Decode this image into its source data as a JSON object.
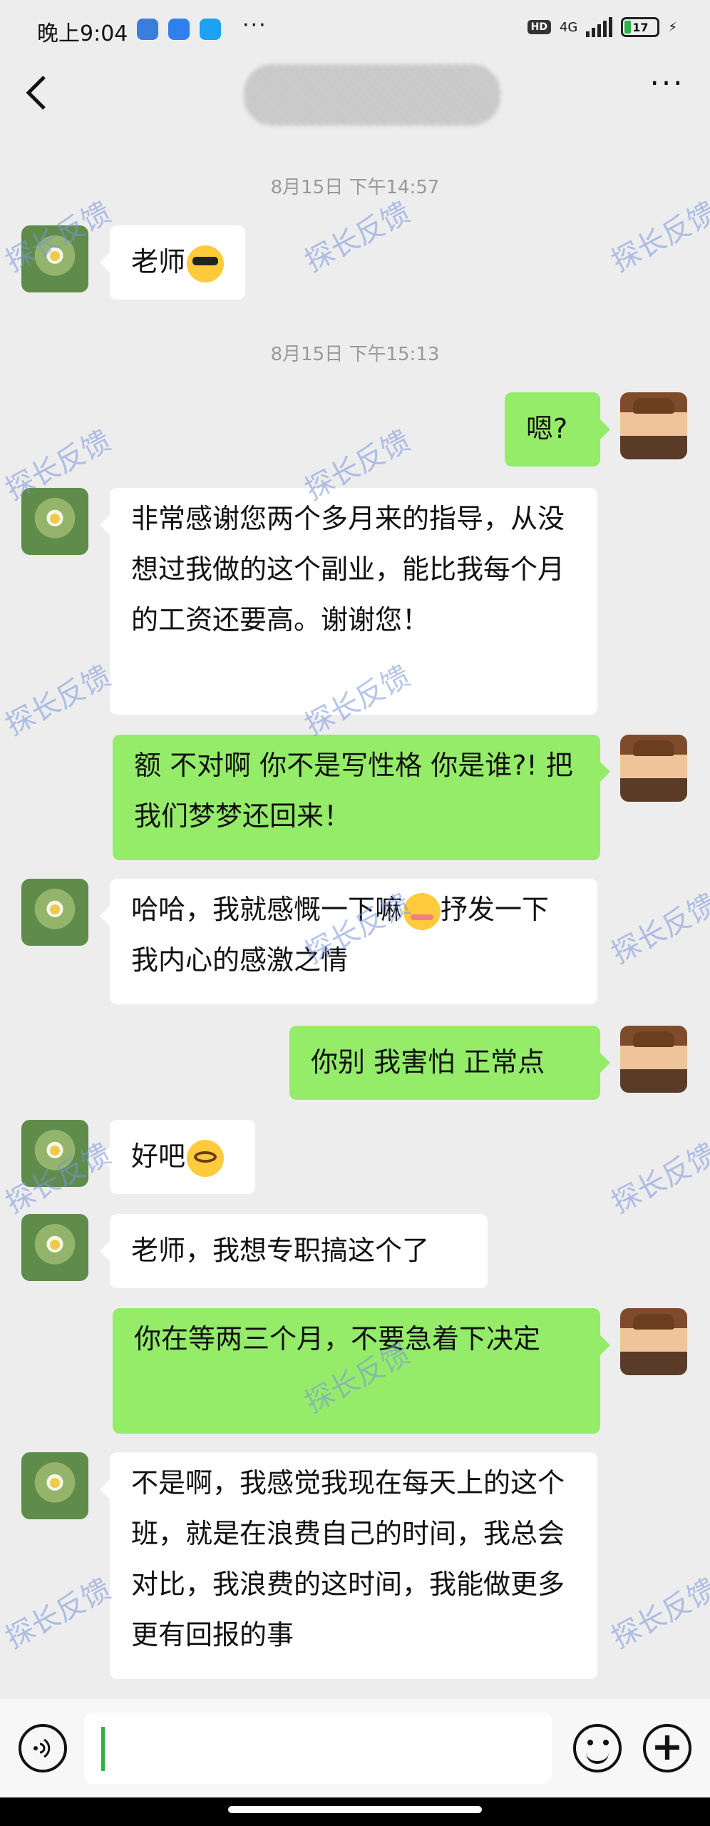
{
  "statusbar": {
    "time": "晚上9:04",
    "more": "···",
    "hd": "HD",
    "network": "4G",
    "battery": "17",
    "app_colors": [
      "#3b7ddd",
      "#2f80ed",
      "#1da1f2"
    ]
  },
  "navbar": {
    "back_icon": "chevron-left-icon",
    "contact_name": "",
    "more_label": "···"
  },
  "chat": {
    "timestamps": [
      "8月15日 下午14:57",
      "8月15日 下午15:13"
    ],
    "messages": [
      {
        "side": "left",
        "text": "老师",
        "emoji": "sunglasses-face"
      },
      {
        "side": "right",
        "text": "嗯?"
      },
      {
        "side": "left",
        "text": "非常感谢您两个多月来的指导，从没想过我做的这个副业，能比我每个月的工资还要高。谢谢您！"
      },
      {
        "side": "right",
        "text": "额 不对啊 你不是写性格 你是谁?! 把我们梦梦还回来！"
      },
      {
        "side": "left",
        "text_before": "哈哈，我就感慨一下嘛",
        "emoji": "blushing-face",
        "text_after": "抒发一下我内心的感激之情"
      },
      {
        "side": "right",
        "text": "你别 我害怕 正常点"
      },
      {
        "side": "left",
        "text": "好吧",
        "emoji": "pleading-face"
      },
      {
        "side": "left",
        "text": "老师，我想专职搞这个了"
      },
      {
        "side": "right",
        "text": "你在等两三个月，不要急着下决定"
      },
      {
        "side": "left",
        "text": "不是啊，我感觉我现在每天上的这个班，就是在浪费自己的时间，我总会对比，我浪费的这时间，我能做更多更有回报的事"
      }
    ]
  },
  "watermark": "探长反馈",
  "inputbar": {
    "voice_icon": "voice-icon",
    "input_value": "",
    "emoji_icon": "emoji-icon",
    "plus_icon": "plus-icon",
    "plus_label": "+"
  },
  "colors": {
    "background": "#ededed",
    "bubble_self": "#95ec69",
    "bubble_other": "#ffffff",
    "cursor": "#2bb34a"
  }
}
